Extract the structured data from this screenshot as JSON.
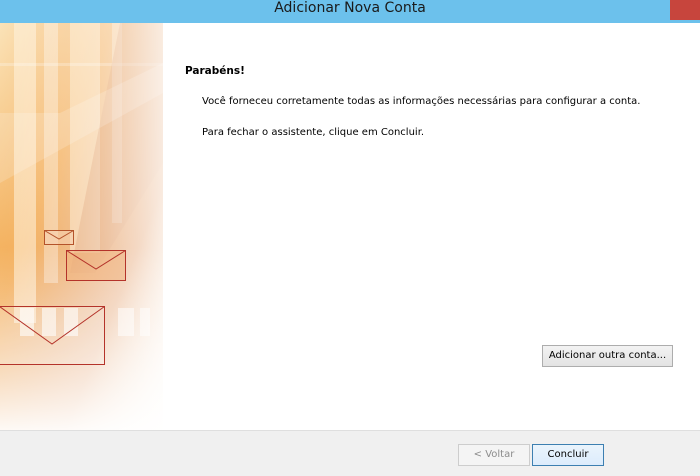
{
  "window": {
    "title": "Adicionar Nova Conta",
    "titlebar_color": "#6cc1ec",
    "close_button_color": "#c7453d"
  },
  "content": {
    "heading": "Parabéns!",
    "message": "Você forneceu corretamente todas as informações necessárias para configurar a conta.",
    "instruction": "Para fechar o assistente, clique em Concluir.",
    "add_account_label": "Adicionar outra conta..."
  },
  "footer": {
    "back_label": "< Voltar",
    "back_enabled": false,
    "finish_label": "Concluir"
  },
  "banner": {
    "icons": [
      "envelope-icon",
      "envelope-icon",
      "envelope-icon"
    ],
    "accent_colors": [
      "#e8822a",
      "#f6c06a",
      "#b4532a"
    ]
  }
}
